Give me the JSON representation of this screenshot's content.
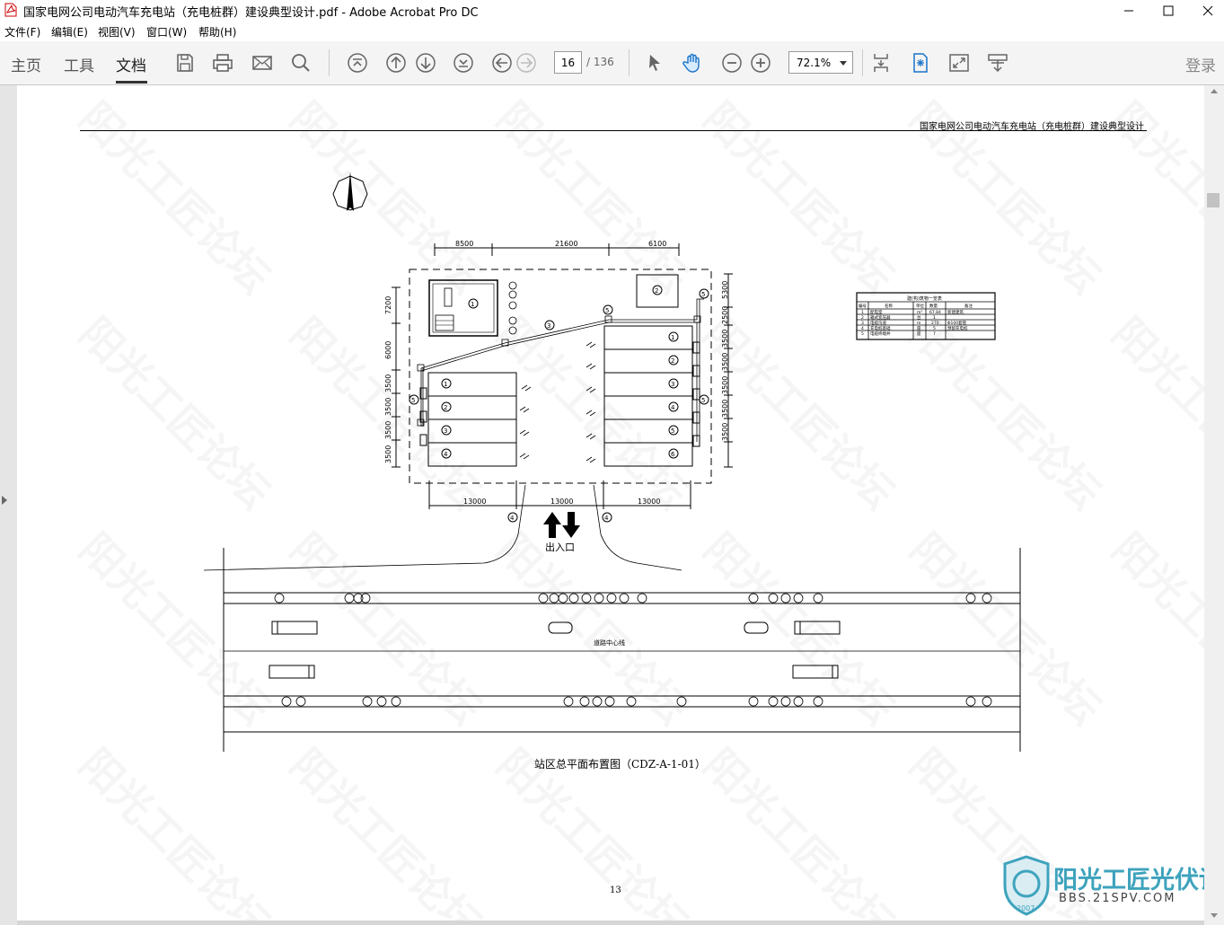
{
  "window": {
    "title": "国家电网公司电动汽车充电站（充电桩群）建设典型设计.pdf - Adobe Acrobat Pro DC"
  },
  "menu": [
    "文件(F)",
    "编辑(E)",
    "视图(V)",
    "窗口(W)",
    "帮助(H)"
  ],
  "tabs": {
    "home": "主页",
    "tools": "工具",
    "document": "文档"
  },
  "nav": {
    "current_page": "16",
    "total_pages": "/ 136"
  },
  "zoom": {
    "value": "72.1%"
  },
  "account": {
    "login": "登录"
  },
  "document": {
    "header": "国家电网公司电动汽车充电站（充电桩群）建设典型设计",
    "top_dims": [
      "8500",
      "21600",
      "6100"
    ],
    "bottom_dims": [
      "13000",
      "13000",
      "13000"
    ],
    "left_dims": [
      "7200",
      "6000",
      "3500",
      "3500",
      "3500",
      "3500"
    ],
    "right_dims": [
      "5300",
      "2500",
      "3500",
      "3500",
      "3500",
      "3500",
      "3500"
    ],
    "entrance": "出入口",
    "road_center": "道路中心线",
    "caption": "站区总平面布置图（CDZ-A-1-01）",
    "page_number": "13",
    "table_title": "建(构)筑物一览表",
    "table_headers": [
      "编号",
      "名称",
      "单位",
      "数量",
      "备注"
    ],
    "table_rows": [
      [
        "1",
        "配电室",
        "m²",
        "67.84",
        "新建建筑"
      ],
      [
        "2",
        "箱式变压器",
        "台",
        "1",
        ""
      ],
      [
        "3",
        "电缆沟道",
        "m",
        "270",
        "Φ100套管"
      ],
      [
        "4",
        "充电桩基础",
        "座",
        "5",
        "预留充电桩"
      ],
      [
        "5",
        "电缆终端井",
        "座",
        "7",
        ""
      ]
    ]
  },
  "watermark": {
    "text": "阳光工匠论坛",
    "logo": "阳光工匠光伏论坛",
    "url": "BBS.21SPV.COM",
    "year": "2007"
  }
}
